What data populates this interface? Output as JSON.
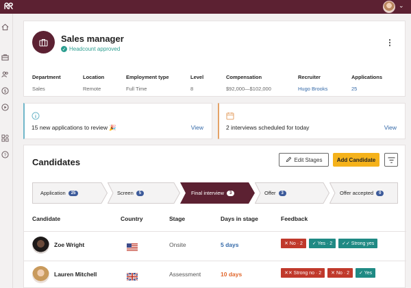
{
  "topbar": {
    "logo": "ᖇᖇ",
    "user_caret": "⌄"
  },
  "sidebar": {
    "icons": [
      "home-icon",
      "briefcase-icon",
      "people-icon",
      "dollar-icon",
      "play-icon",
      "apps-icon",
      "help-icon"
    ]
  },
  "job": {
    "title": "Sales manager",
    "headcount_status": "Headcount approved",
    "menu_glyph": "⋮",
    "fields": [
      {
        "label": "Department",
        "value": "Sales"
      },
      {
        "label": "Location",
        "value": "Remote"
      },
      {
        "label": "Employment type",
        "value": "Full Time"
      },
      {
        "label": "Level",
        "value": "8"
      },
      {
        "label": "Compensation",
        "value": "$92,000—$102,000"
      },
      {
        "label": "Recruiter",
        "value": "Hugo Brooks"
      },
      {
        "label": "Applications",
        "value": "25"
      }
    ]
  },
  "notices": [
    {
      "text": "15 new applications to review 🎉",
      "action": "View",
      "icon": "info-icon"
    },
    {
      "text": "2 interviews scheduled for today",
      "action": "View",
      "icon": "calendar-icon"
    }
  ],
  "candidates": {
    "title": "Candidates",
    "edit_stages_label": "Edit Stages",
    "add_candidate_label": "Add Candidate",
    "stages": [
      {
        "label": "Application",
        "count": "25"
      },
      {
        "label": "Screen",
        "count": "5"
      },
      {
        "label": "Final interview",
        "count": "3",
        "active": true
      },
      {
        "label": "Offer",
        "count": "3"
      },
      {
        "label": "Offer accepted",
        "count": "0"
      }
    ],
    "columns": [
      "Candidate",
      "Country",
      "Stage",
      "Days in stage",
      "Feedback"
    ],
    "rows": [
      {
        "name": "Zoe Wright",
        "country_flag": "us-flag",
        "stage": "Onsite",
        "days": "5 days",
        "days_color": "#3469a8",
        "feedback": [
          {
            "text": "✕ No · 2",
            "color": "red"
          },
          {
            "text": "✓ Yes · 2",
            "color": "teal"
          },
          {
            "text": "✓✓ Strong yes",
            "color": "teal"
          }
        ]
      },
      {
        "name": "Lauren Mitchell",
        "country_flag": "uk-flag",
        "stage": "Assessment",
        "days": "10 days",
        "days_color": "#e0662b",
        "feedback": [
          {
            "text": "✕✕ Strong no · 2",
            "color": "red"
          },
          {
            "text": "✕ No · 2",
            "color": "red"
          },
          {
            "text": "✓ Yes",
            "color": "teal"
          }
        ]
      }
    ]
  },
  "colors": {
    "brand": "#5c2132",
    "accent": "#f5b21b",
    "link": "#3469a8",
    "positive": "#2a9d8f"
  }
}
